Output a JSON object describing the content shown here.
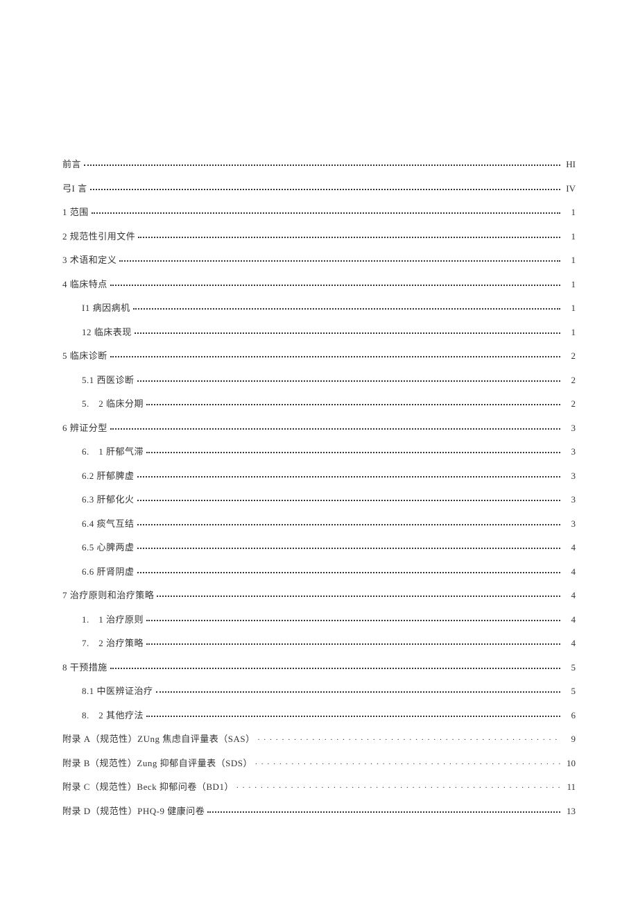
{
  "toc": [
    {
      "level": 1,
      "label": "前言",
      "page": "HI",
      "leader": "dense"
    },
    {
      "level": 1,
      "label": "弓I 言",
      "page": "IV",
      "leader": "dense"
    },
    {
      "level": 1,
      "label": "1 范围",
      "page": "1",
      "leader": "dense"
    },
    {
      "level": 1,
      "label": "2 规范性引用文件",
      "page": "1",
      "leader": "dense"
    },
    {
      "level": 1,
      "label": "3 术语和定义",
      "page": "1",
      "leader": "dense"
    },
    {
      "level": 1,
      "label": "4 临床特点",
      "page": "1",
      "leader": "dense"
    },
    {
      "level": 2,
      "label": "I1 病因病机",
      "page": "1",
      "leader": "dense"
    },
    {
      "level": 2,
      "label": "12 临床表现",
      "page": "1",
      "leader": "dense"
    },
    {
      "level": 1,
      "label": "5 临床诊断",
      "page": "2",
      "leader": "dense"
    },
    {
      "level": 2,
      "label": "5.1 西医诊断",
      "page": "2",
      "leader": "dense"
    },
    {
      "level": 2,
      "label": "5.　2 临床分期",
      "page": "2",
      "leader": "dense"
    },
    {
      "level": 1,
      "label": "6 辨证分型",
      "page": "3",
      "leader": "dense"
    },
    {
      "level": 2,
      "label": "6.　1 肝郁气滞",
      "page": "3",
      "leader": "dense"
    },
    {
      "level": 2,
      "label": "6.2 肝郁脾虚",
      "page": "3",
      "leader": "dense"
    },
    {
      "level": 2,
      "label": "6.3 肝郁化火",
      "page": "3",
      "leader": "dense"
    },
    {
      "level": 2,
      "label": "6.4 痰气互结",
      "page": "3",
      "leader": "dense"
    },
    {
      "level": 2,
      "label": "6.5 心脾两虚",
      "page": "4",
      "leader": "dense"
    },
    {
      "level": 2,
      "label": "6.6 肝肾阴虚",
      "page": "4",
      "leader": "dense"
    },
    {
      "level": 1,
      "label": "7 治疗原则和治疗策略",
      "page": "4",
      "leader": "dense"
    },
    {
      "level": 2,
      "label": "1.　1 治疗原则",
      "page": "4",
      "leader": "dense"
    },
    {
      "level": 2,
      "label": "7.　2 治疗策略",
      "page": "4",
      "leader": "dense"
    },
    {
      "level": 1,
      "label": "8 干预措施",
      "page": "5",
      "leader": "dense"
    },
    {
      "level": 2,
      "label": "8.1 中医辨证治疗",
      "page": "5",
      "leader": "dense"
    },
    {
      "level": 2,
      "label": "8.　2 其他疗法",
      "page": "6",
      "leader": "dense"
    },
    {
      "level": 1,
      "label": "附录 A（规范性）ZUng 焦虑自评量表（SAS）",
      "page": "9",
      "leader": "sparse"
    },
    {
      "level": 1,
      "label": "附录 B（规范性）Zung 抑郁自评量表（SDS）",
      "page": "10",
      "leader": "sparse"
    },
    {
      "level": 1,
      "label": "附录 C（规范性）Beck 抑郁问卷（BD1）",
      "page": "11",
      "leader": "sparse"
    },
    {
      "level": 1,
      "label": "附录 D（规范性）PHQ-9 健康问卷",
      "page": "13",
      "leader": "dense"
    }
  ]
}
